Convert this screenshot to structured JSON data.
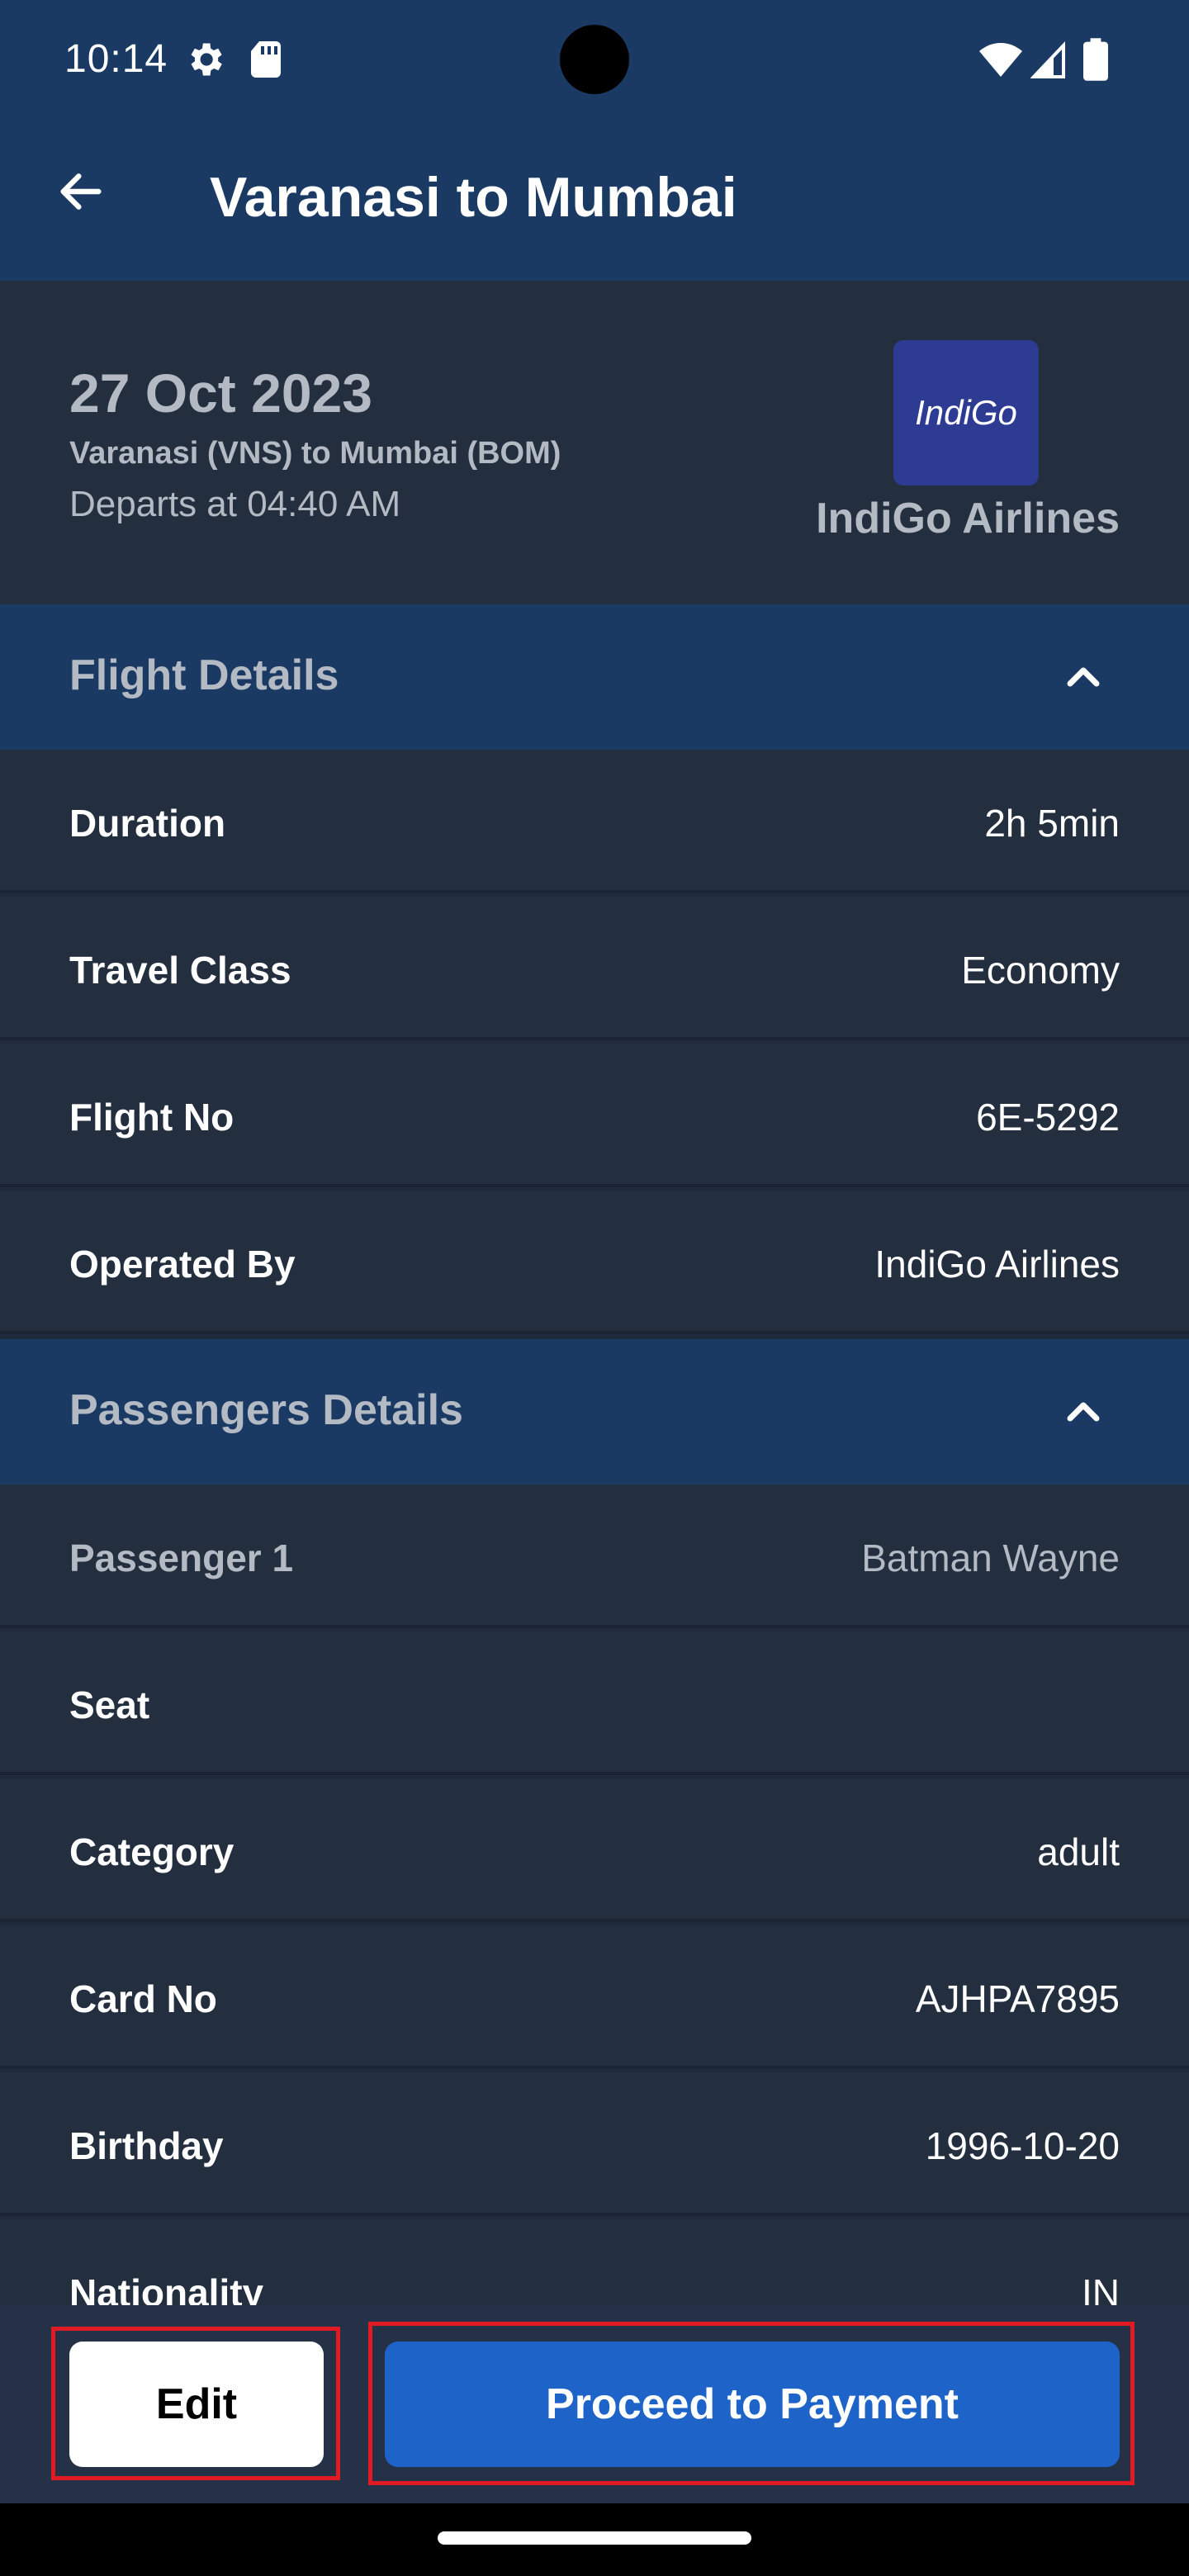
{
  "status_bar": {
    "time": "10:14",
    "icons": [
      "gear-icon",
      "sd-card-icon",
      "wifi-icon",
      "signal-icon",
      "battery-icon"
    ]
  },
  "app_bar": {
    "title": "Varanasi to Mumbai",
    "back_icon": "arrow-left-icon"
  },
  "flight_summary": {
    "date": "27 Oct 2023",
    "route": "Varanasi  (VNS) to Mumbai  (BOM)",
    "departs": "Departs at 04:40 AM",
    "airline_logo_text": "IndiGo",
    "airline_name": "IndiGo Airlines"
  },
  "flight_details": {
    "title": "Flight Details",
    "rows": [
      {
        "label": "Duration",
        "value": "2h 5min"
      },
      {
        "label": "Travel Class",
        "value": "Economy"
      },
      {
        "label": "Flight No",
        "value": "6E-5292"
      },
      {
        "label": "Operated By",
        "value": "IndiGo Airlines"
      }
    ]
  },
  "passenger_details": {
    "title": "Passengers Details",
    "rows": [
      {
        "label": "Passenger 1",
        "value": "Batman Wayne"
      },
      {
        "label": "Seat",
        "value": ""
      },
      {
        "label": "Category",
        "value": "adult"
      },
      {
        "label": "Card No",
        "value": "AJHPA7895"
      },
      {
        "label": "Birthday",
        "value": "1996-10-20"
      },
      {
        "label": "Nationality",
        "value": "IN"
      }
    ]
  },
  "actions": {
    "edit_label": "Edit",
    "pay_label": "Proceed to Payment"
  },
  "colors": {
    "app_bar": "#1b3a63",
    "background": "#232e3e",
    "primary_button": "#1e64c8",
    "highlight_border": "#e01b24"
  }
}
